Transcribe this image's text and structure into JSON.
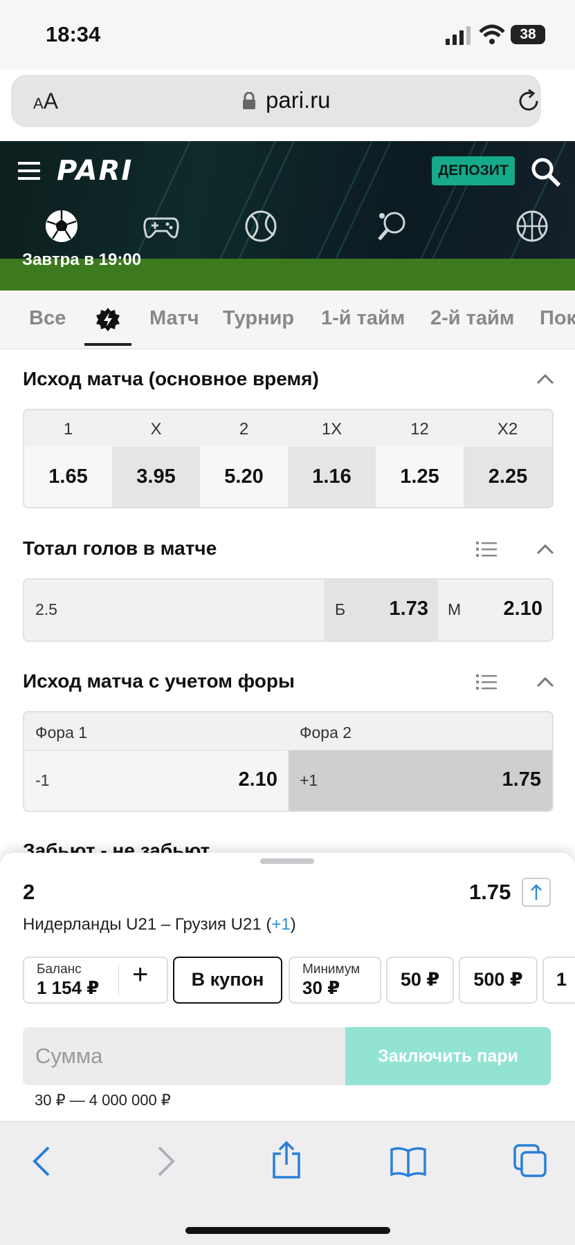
{
  "status_bar": {
    "time": "18:34",
    "battery": "38"
  },
  "browser": {
    "text_size_label_small": "A",
    "text_size_label_large": "A",
    "url": "pari.ru"
  },
  "header": {
    "logo": "PARI",
    "deposit_label": "ДЕПОЗИТ",
    "sport_icons": [
      "football-icon",
      "esports-icon",
      "tennis-icon",
      "table-tennis-icon",
      "basketball-icon"
    ]
  },
  "match_banner": {
    "text": "Завтра в 19:00"
  },
  "tabs": [
    {
      "label": "Все"
    },
    {
      "label": "",
      "icon": "flash-icon",
      "active": true
    },
    {
      "label": "Матч"
    },
    {
      "label": "Турнир"
    },
    {
      "label": "1-й тайм"
    },
    {
      "label": "2-й тайм"
    },
    {
      "label": "Пок"
    }
  ],
  "markets": {
    "outcome": {
      "title": "Исход матча (основное время)",
      "headers": [
        "1",
        "X",
        "2",
        "1X",
        "12",
        "X2"
      ],
      "odds": [
        "1.65",
        "3.95",
        "5.20",
        "1.16",
        "1.25",
        "2.25"
      ]
    },
    "total": {
      "title": "Тотал голов в матче",
      "line": "2.5",
      "over_label": "Б",
      "over_odd": "1.73",
      "under_label": "М",
      "under_odd": "2.10"
    },
    "handicap": {
      "title": "Исход матча с учетом форы",
      "h1_label": "Фора 1",
      "h2_label": "Фора 2",
      "h1_line": "-1",
      "h1_odd": "2.10",
      "h2_line": "+1",
      "h2_odd": "1.75"
    },
    "next_title": "Забьют - не забьют"
  },
  "bet_slip": {
    "selection": "2",
    "odd": "1.75",
    "match": "Нидерланды U21 – Грузия U21",
    "extra": "+1",
    "balance_label": "Баланс",
    "balance_value": "1 154 ₽",
    "plus": "+",
    "coupon_label": "В купон",
    "min_label": "Минимум",
    "min_value": "30 ₽",
    "quick1": "50 ₽",
    "quick2": "500 ₽",
    "quick3": "1",
    "sum_placeholder": "Сумма",
    "make_bet": "Заключить пари",
    "range": "30 ₽ — 4 000 000 ₽"
  },
  "colors": {
    "accent": "#16a98a",
    "green_bar": "#3d7a1f",
    "link": "#2a8fd8",
    "make_bet_bg": "#93e3d3"
  }
}
